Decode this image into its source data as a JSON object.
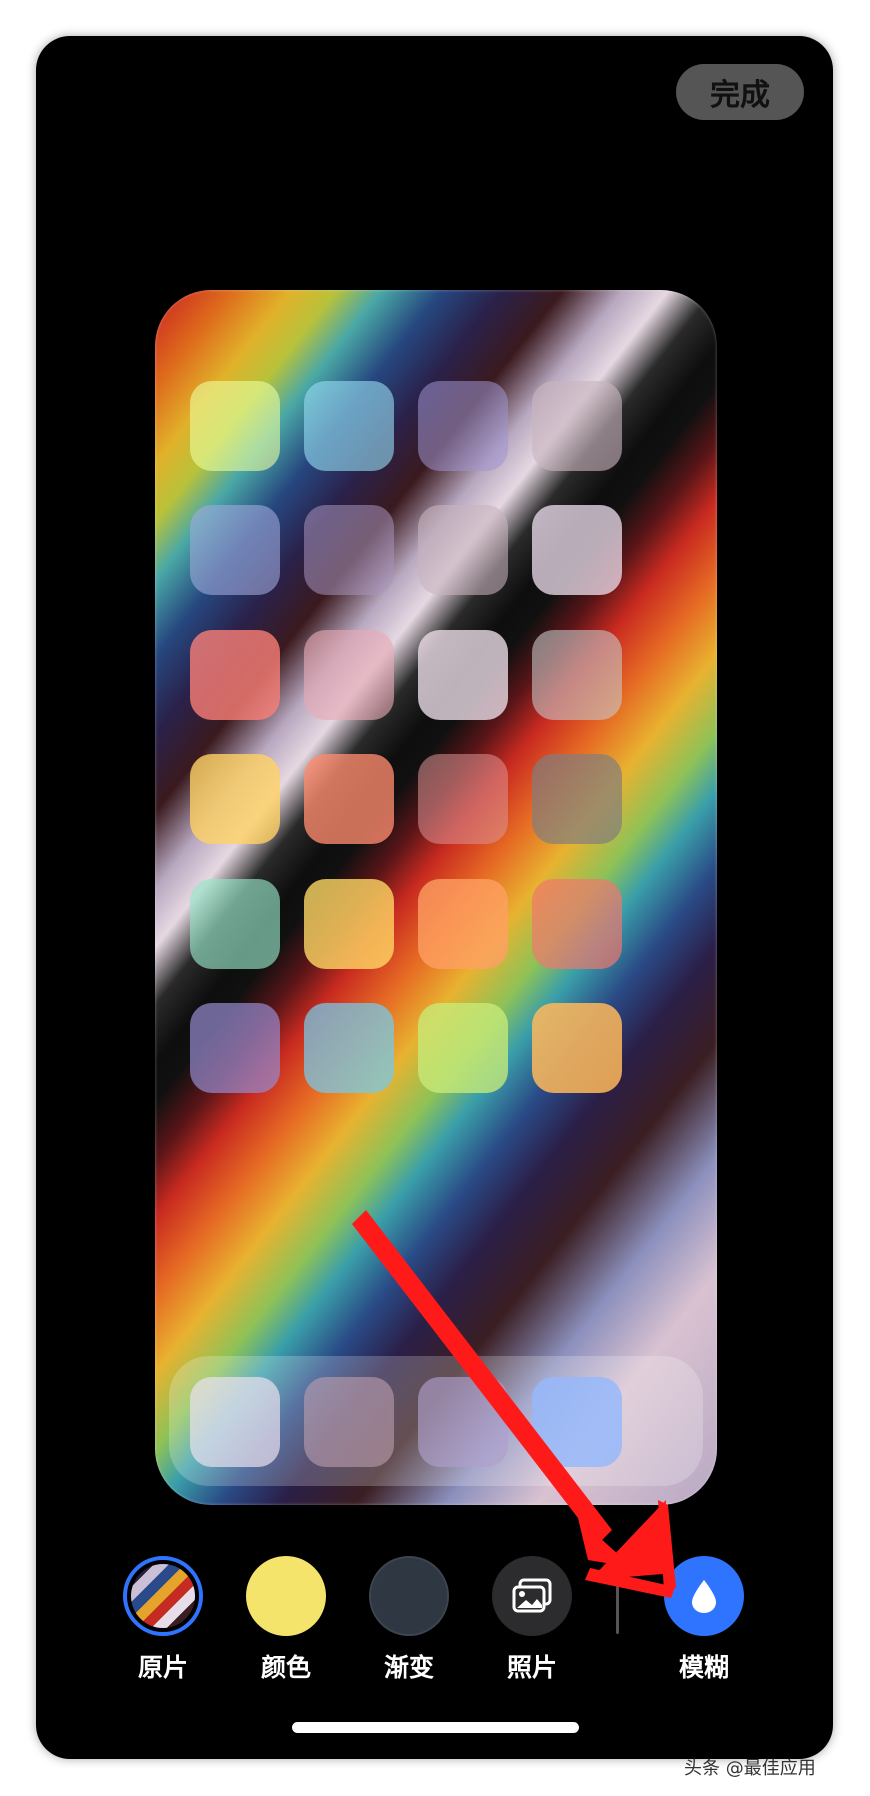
{
  "header": {
    "done_label": "完成"
  },
  "preview": {
    "app_rows": 6,
    "app_cols": 4,
    "dock_icons": 4
  },
  "toolbar": {
    "items": [
      {
        "label": "原片",
        "icon": "original-wallpaper-swatch",
        "selected": true
      },
      {
        "label": "颜色",
        "icon": "color-swatch"
      },
      {
        "label": "渐变",
        "icon": "gradient-swatch"
      },
      {
        "label": "照片",
        "icon": "photos-icon"
      },
      {
        "label": "模糊",
        "icon": "blur-drop-icon",
        "selected": true
      }
    ],
    "accent_color": "#2f74ff"
  },
  "annotation": {
    "arrow_color": "#ff1a1a"
  },
  "watermark": {
    "text": "头条 @最佳应用"
  }
}
